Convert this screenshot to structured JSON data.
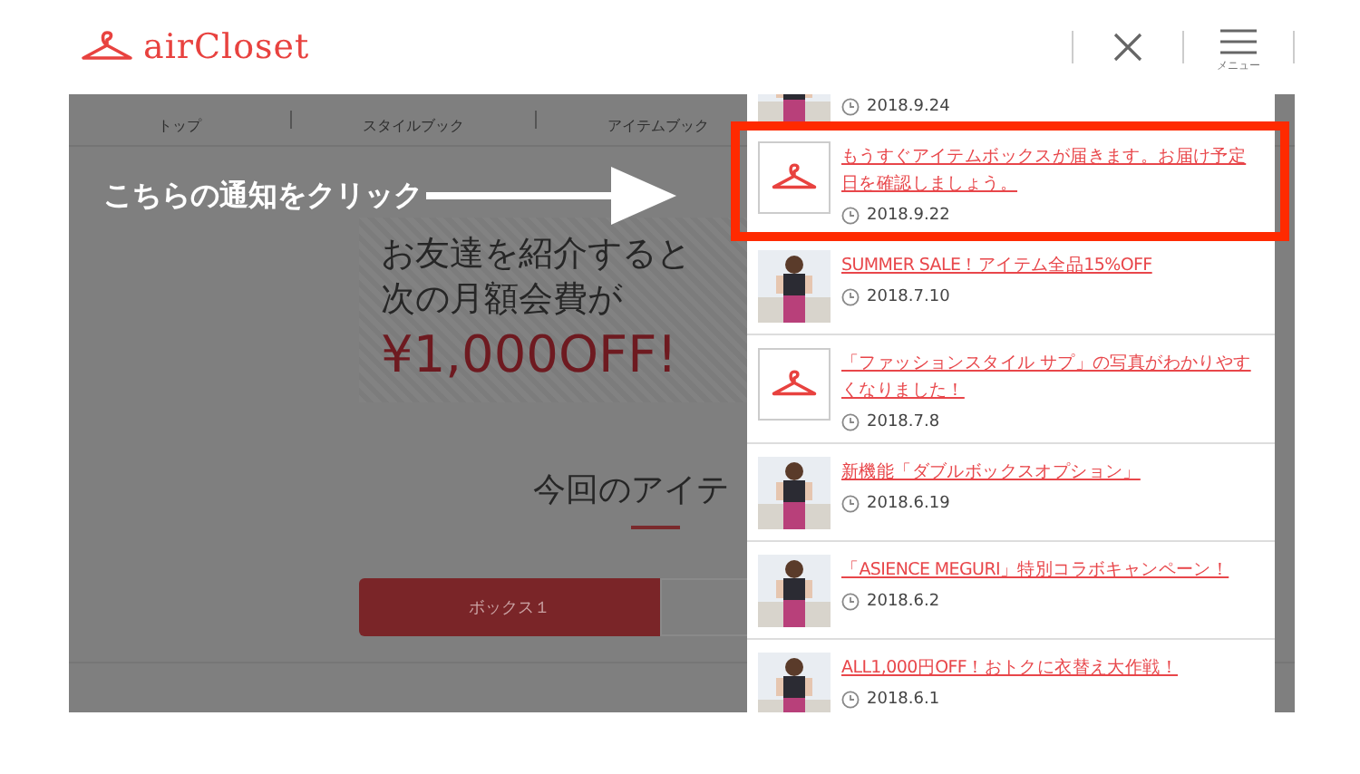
{
  "header": {
    "logo": "airCloset",
    "menu_label": "メニュー"
  },
  "nav": [
    "トップ",
    "スタイルブック",
    "アイテムブック"
  ],
  "annotation": {
    "text": "こちらの通知をクリック"
  },
  "banner": {
    "lines": [
      "お友達を紹介すると",
      "次の月額会費が"
    ],
    "offer": "¥1,000OFF!"
  },
  "section": {
    "heading": "今回のアイテ",
    "tabs": [
      {
        "label": "ボックス１",
        "selected": true
      },
      {
        "selected": false
      }
    ]
  },
  "notifications": [
    {
      "date": "2018.9.24",
      "highlighted": false
    },
    {
      "kind": "hanger",
      "title": "もうすぐアイテムボックスが届きます。お届け予定日を確認しましょう。",
      "date": "2018.9.22",
      "highlighted": true
    },
    {
      "title": "SUMMER SALE！アイテム全品15%OFF",
      "date": "2018.7.10",
      "highlighted": false
    },
    {
      "kind": "hanger",
      "title": "「ファッションスタイル サプ」の写真がわかりやすくなりました！",
      "date": "2018.7.8",
      "highlighted": false
    },
    {
      "title": "新機能「ダブルボックスオプション」",
      "date": "2018.6.19",
      "highlighted": false
    },
    {
      "title": "「ASIENCE MEGURI」特別コラボキャンペーン！",
      "date": "2018.6.2",
      "highlighted": false
    },
    {
      "title": "ALL1,000円OFF！おトクに衣替え大作戦！",
      "date": "2018.6.1",
      "highlighted": false
    }
  ]
}
